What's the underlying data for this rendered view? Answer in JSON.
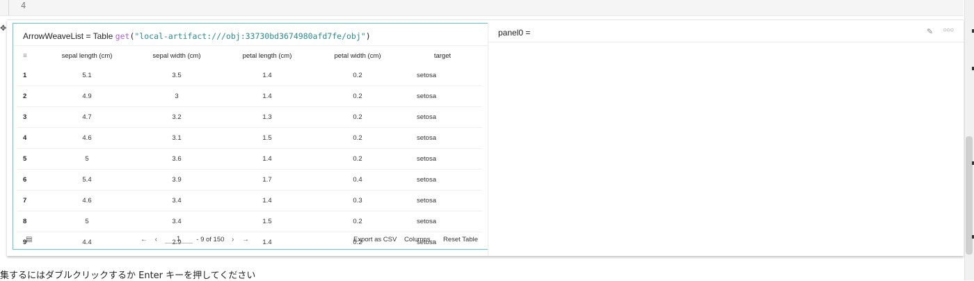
{
  "editor": {
    "line_number": "4"
  },
  "left_panel": {
    "var_name": "ArrowWeaveList",
    "equals": "=",
    "type_name": "Table",
    "fn_name": "get",
    "paren_open": "(",
    "path": "\"local-artifact:///obj:33730bd3674980afd7fe/obj\"",
    "paren_close": ")",
    "columns": [
      "sepal length (cm)",
      "sepal width (cm)",
      "petal length (cm)",
      "petal width (cm)",
      "target"
    ],
    "rows": [
      {
        "idx": "1",
        "cells": [
          "5.1",
          "3.5",
          "1.4",
          "0.2",
          "setosa"
        ]
      },
      {
        "idx": "2",
        "cells": [
          "4.9",
          "3",
          "1.4",
          "0.2",
          "setosa"
        ]
      },
      {
        "idx": "3",
        "cells": [
          "4.7",
          "3.2",
          "1.3",
          "0.2",
          "setosa"
        ]
      },
      {
        "idx": "4",
        "cells": [
          "4.6",
          "3.1",
          "1.5",
          "0.2",
          "setosa"
        ]
      },
      {
        "idx": "5",
        "cells": [
          "5",
          "3.6",
          "1.4",
          "0.2",
          "setosa"
        ]
      },
      {
        "idx": "6",
        "cells": [
          "5.4",
          "3.9",
          "1.7",
          "0.4",
          "setosa"
        ]
      },
      {
        "idx": "7",
        "cells": [
          "4.6",
          "3.4",
          "1.4",
          "0.3",
          "setosa"
        ]
      },
      {
        "idx": "8",
        "cells": [
          "5",
          "3.4",
          "1.5",
          "0.2",
          "setosa"
        ]
      },
      {
        "idx": "9",
        "cells": [
          "4.4",
          "2.9",
          "1.4",
          "0.2",
          "setosa"
        ]
      }
    ],
    "pagination": {
      "first_glyph": "←",
      "prev_glyph": "‹",
      "current_page": "1",
      "range_text": "- 9 of 150",
      "next_glyph": "›",
      "last_glyph": "→"
    },
    "actions": {
      "export": "Export as CSV",
      "columns": "Columns...",
      "reset": "Reset Table"
    }
  },
  "right_panel": {
    "title": "panel0 ="
  },
  "status": {
    "hint": "集するにはダブルクリックするか Enter キーを押してください"
  },
  "icons": {
    "filter": "filter-icon",
    "table": "table-icon",
    "edit": "pencil-icon",
    "more": "more-icon",
    "move": "move-handle-icon"
  },
  "colors": {
    "panel_border": "#5ecccf",
    "fn": "#b15fcf",
    "string": "#2a8c8f"
  }
}
